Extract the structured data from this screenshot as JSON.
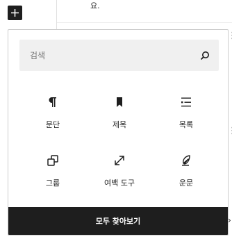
{
  "editor": {
    "paragraph_tail": "요."
  },
  "toolbar": {
    "inserter_icon": "plus-icon"
  },
  "inserter": {
    "search": {
      "placeholder": "검색",
      "icon": "search-icon"
    },
    "blocks": [
      {
        "label": "문단",
        "icon": "paragraph-icon"
      },
      {
        "label": "제목",
        "icon": "bookmark-icon"
      },
      {
        "label": "목록",
        "icon": "list-icon"
      },
      {
        "label": "그룹",
        "icon": "group-icon"
      },
      {
        "label": "여백 도구",
        "icon": "resize-icon"
      },
      {
        "label": "운문",
        "icon": "feather-icon"
      }
    ],
    "browse_all_label": "모두 찾아보기"
  },
  "colors": {
    "dark": "#1e1e1e",
    "search_bg": "#f0f0f0",
    "border": "#cccccc"
  }
}
